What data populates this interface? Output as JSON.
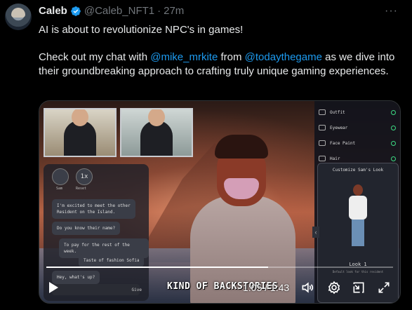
{
  "tweet": {
    "author_name": "Caleb",
    "handle": "@Caleb_NFT1",
    "separator": "·",
    "time": "27m",
    "more_label": "···",
    "text_line1": "AI is about to revolutionize NPC's in games!",
    "text_p2_a": "Check out my chat with ",
    "mention1": "@mike_mrkite",
    "text_p2_b": " from ",
    "mention2": "@todaythegame",
    "text_p2_c": " as we dive into their groundbreaking approach to crafting truly unique gaming experiences."
  },
  "video": {
    "chat": {
      "chip1_label": "Sam",
      "chip2_text": "1x",
      "chip2_label": "Reset",
      "messages": [
        "I'm excited to meet the other\nResident on the Island.",
        "Do you know their name?",
        "To pay for the rest of the week.",
        "Taste of fashion Sofia",
        "Hey, what's up?"
      ],
      "send_label": "Give"
    },
    "options": [
      "Outfit",
      "Eyewear",
      "Face Paint",
      "Hair"
    ],
    "customize_title": "Customize Sam's Look",
    "look_label": "Look 1",
    "look_sub": "Default look for this resident",
    "subtitle": "KIND OF BACKSTORIES",
    "progress": 0.64,
    "current_time": "1:05",
    "time_separator": " / ",
    "duration": "1:43"
  },
  "colors": {
    "accent": "#1d9bf0",
    "muted": "#71767b",
    "text": "#e7e9ea",
    "background": "#000000"
  },
  "icons": [
    "verified-badge-icon",
    "more-icon",
    "play-icon",
    "volume-icon",
    "settings-icon",
    "pip-icon",
    "fullscreen-icon"
  ]
}
